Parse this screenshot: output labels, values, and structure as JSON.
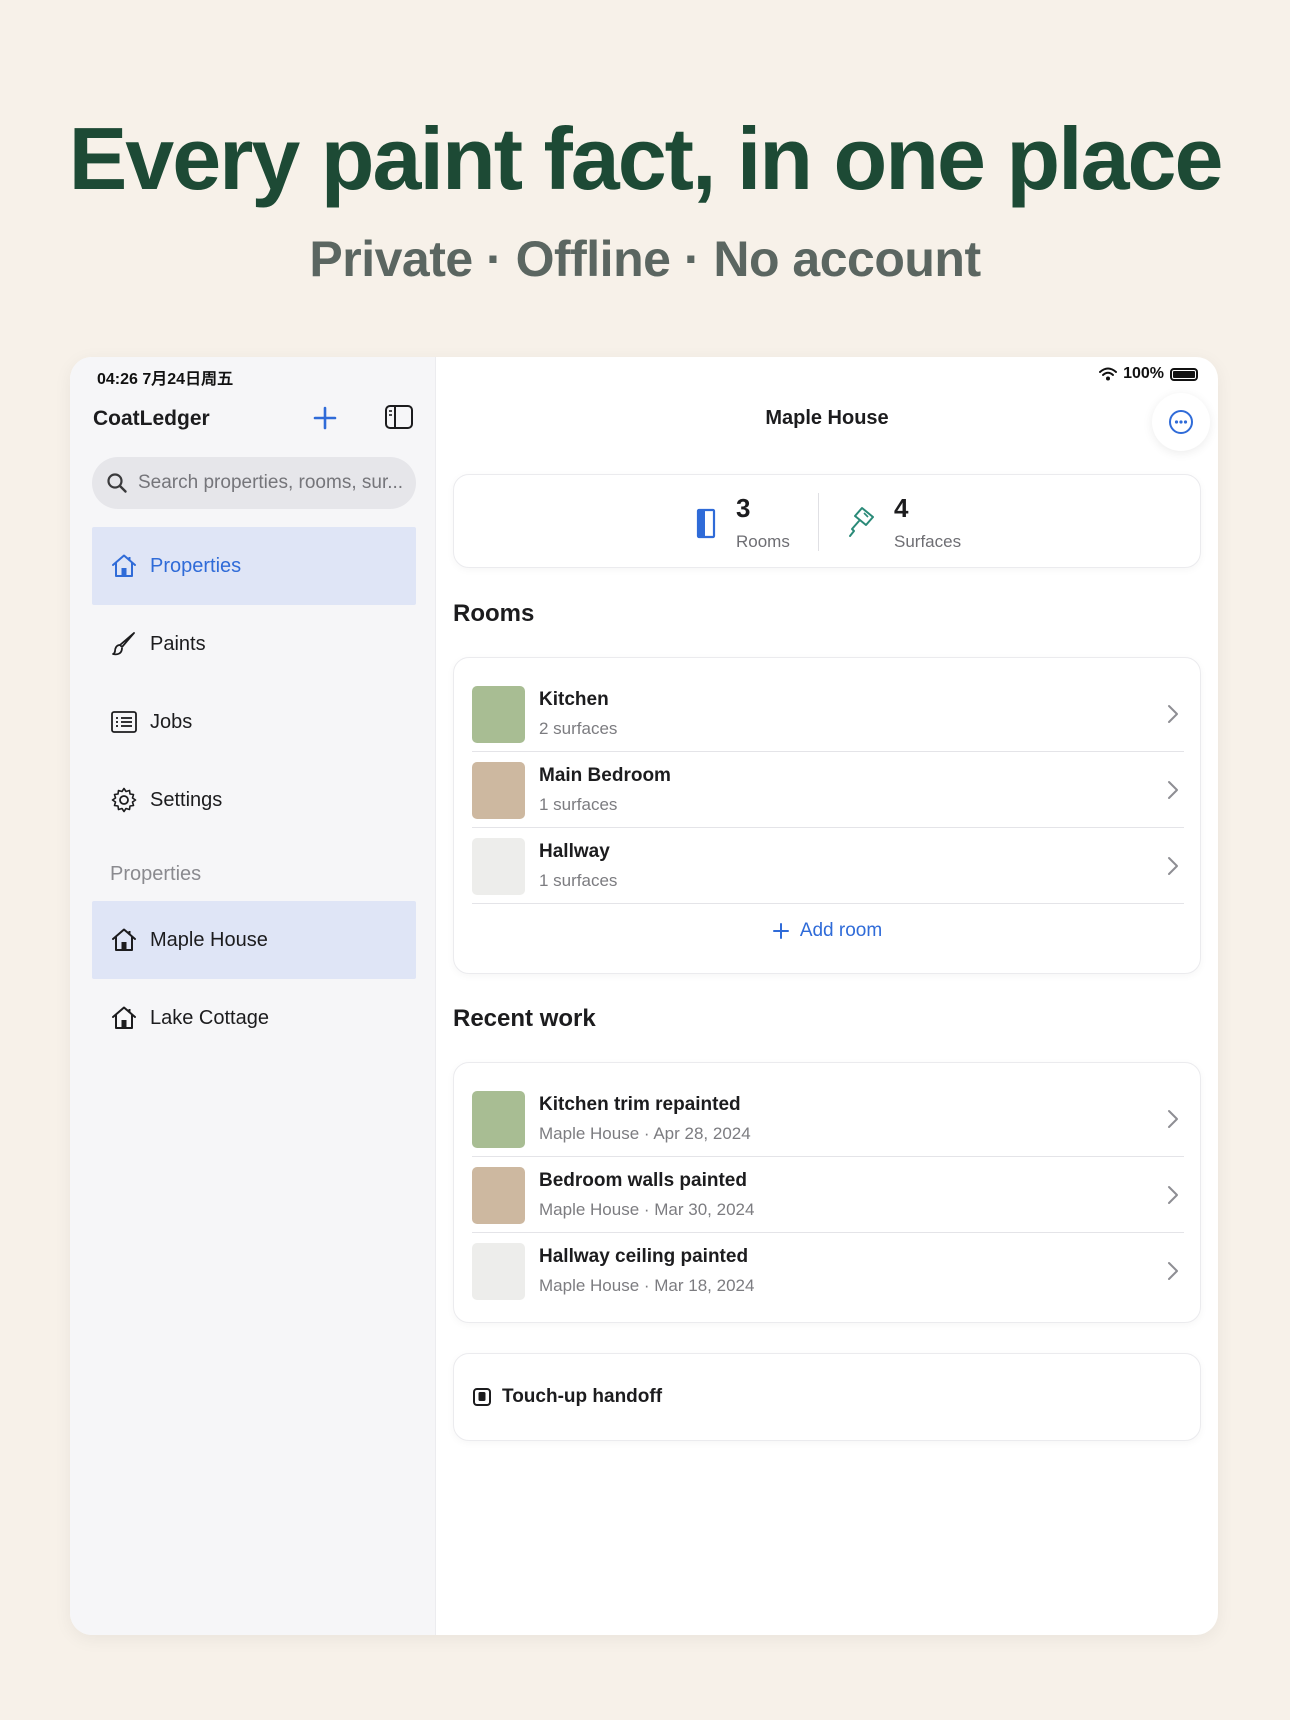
{
  "hero": {
    "headline": "Every paint fact, in one place",
    "subline": "Private · Offline · No account"
  },
  "status_bar": {
    "time": "04:26  7月24日周五",
    "battery": "100%"
  },
  "sidebar": {
    "app_title": "CoatLedger",
    "search_placeholder": "Search properties, rooms, sur...",
    "nav": [
      {
        "label": "Properties",
        "icon": "house-icon",
        "active": true
      },
      {
        "label": "Paints",
        "icon": "paintbrush-icon",
        "active": false
      },
      {
        "label": "Jobs",
        "icon": "list-icon",
        "active": false
      },
      {
        "label": "Settings",
        "icon": "gear-icon",
        "active": false
      }
    ],
    "section_label": "Properties",
    "properties": [
      {
        "label": "Maple House",
        "icon": "house-icon",
        "active": true
      },
      {
        "label": "Lake Cottage",
        "icon": "house-icon",
        "active": false
      }
    ]
  },
  "main": {
    "title": "Maple House",
    "stats": [
      {
        "value": "3",
        "label": "Rooms",
        "icon": "door-icon"
      },
      {
        "value": "4",
        "label": "Surfaces",
        "icon": "paint-roller-icon"
      }
    ],
    "rooms_title": "Rooms",
    "rooms": [
      {
        "name": "Kitchen",
        "detail": "2 surfaces",
        "color": "#a8bd93"
      },
      {
        "name": "Main Bedroom",
        "detail": "1 surfaces",
        "color": "#cdb8a0"
      },
      {
        "name": "Hallway",
        "detail": "1 surfaces",
        "color": "#ededeb"
      }
    ],
    "add_room_label": "Add room",
    "recent_title": "Recent work",
    "recent": [
      {
        "title": "Kitchen trim repainted",
        "detail": "Maple House · Apr 28, 2024",
        "color": "#a8bd93"
      },
      {
        "title": "Bedroom walls painted",
        "detail": "Maple House · Mar 30, 2024",
        "color": "#cdb8a0"
      },
      {
        "title": "Hallway ceiling painted",
        "detail": "Maple House · Mar 18, 2024",
        "color": "#ededeb"
      }
    ],
    "handoff_label": "Touch-up handoff"
  },
  "colors": {
    "accent": "#2f6bd8",
    "headline": "#1d4a35",
    "background": "#f7f1e9",
    "active_row": "#dfe5f6"
  }
}
